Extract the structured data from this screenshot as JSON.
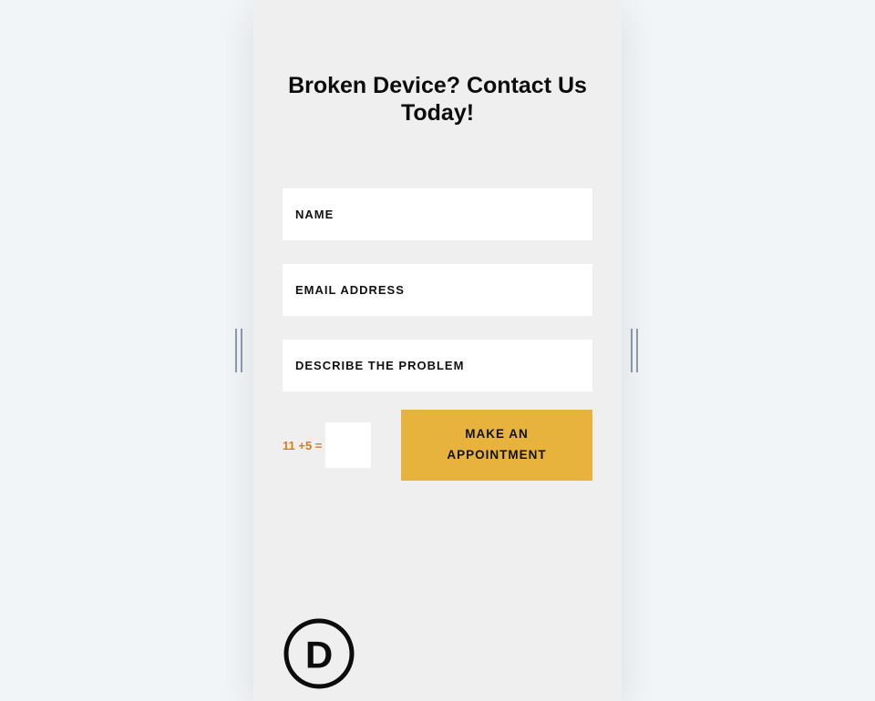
{
  "form": {
    "heading": "Broken Device? Contact Us Today!",
    "name_placeholder": "NAME",
    "email_placeholder": "EMAIL ADDRESS",
    "describe_placeholder": "DESCRIBE THE PROBLEM",
    "captcha_question": "11 +5 =",
    "submit_label": "MAKE AN\nAPPOINTMENT"
  },
  "logo": {
    "letter": "D"
  },
  "colors": {
    "page_bg": "#f2f5f8",
    "card_bg": "#efefef",
    "field_bg": "#ffffff",
    "accent": "#e7b33d",
    "captcha_text": "#d97a20",
    "text": "#0c0c0c"
  }
}
